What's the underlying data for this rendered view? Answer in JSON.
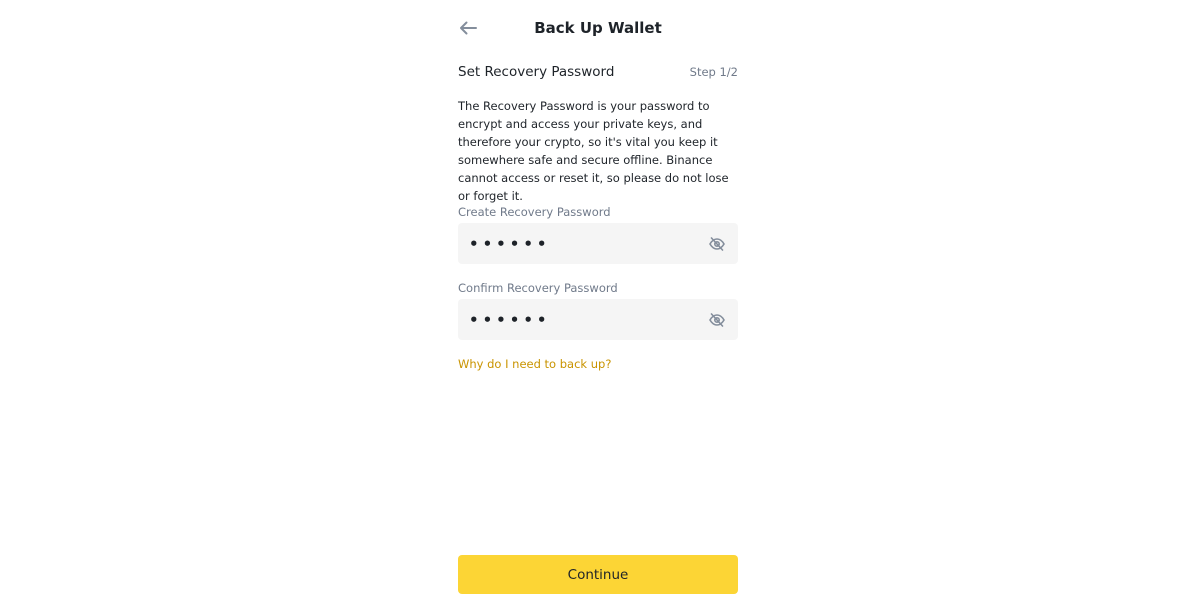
{
  "header": {
    "back_icon": "arrow-left-icon",
    "title": "Back Up Wallet"
  },
  "section": {
    "title": "Set Recovery Password",
    "step": "Step 1/2"
  },
  "description": "The Recovery Password is your password to encrypt and access your private keys, and therefore your crypto, so it's vital you keep it somewhere safe and secure offline. Binance cannot access or reset it, so please do not lose or forget it.",
  "fields": {
    "create": {
      "label": "Create Recovery Password",
      "value": "••••••",
      "toggle_icon": "eye-off-icon"
    },
    "confirm": {
      "label": "Confirm Recovery Password",
      "value": "••••••",
      "toggle_icon": "eye-off-icon"
    }
  },
  "help_link": "Why do I need to back up?",
  "continue_label": "Continue",
  "colors": {
    "accent": "#fcd535",
    "link": "#c99400",
    "input_bg": "#f5f5f5",
    "text_primary": "#1e2329",
    "text_secondary": "#707a8a"
  }
}
